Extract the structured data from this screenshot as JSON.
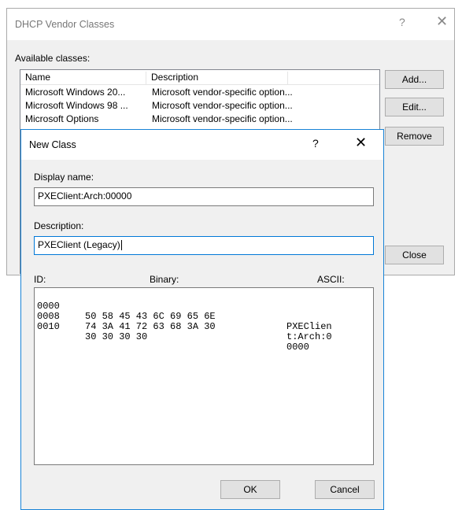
{
  "vendor_dialog": {
    "title": "DHCP Vendor Classes",
    "help_glyph": "?",
    "close_glyph": "✕",
    "available_label": "Available classes:",
    "columns": [
      "Name",
      "Description"
    ],
    "rows": [
      {
        "name": "Microsoft Windows 20...",
        "description": "Microsoft vendor-specific option..."
      },
      {
        "name": "Microsoft Windows 98 ...",
        "description": "Microsoft vendor-specific option..."
      },
      {
        "name": "Microsoft Options",
        "description": "Microsoft vendor-specific option..."
      }
    ],
    "buttons": {
      "add": "Add...",
      "edit": "Edit...",
      "remove": "Remove",
      "close": "Close"
    }
  },
  "new_class_dialog": {
    "title": "New Class",
    "help_glyph": "?",
    "close_glyph": "✕",
    "display_name_label": "Display name:",
    "display_name_value": "PXEClient:Arch:00000",
    "description_label": "Description:",
    "description_value": "PXEClient (Legacy)",
    "id_label": "ID:",
    "binary_label": "Binary:",
    "ascii_label": "ASCII:",
    "hex_rows": [
      {
        "offset": "0000",
        "binary": "50 58 45 43 6C 69 65 6E",
        "ascii": "PXEClien"
      },
      {
        "offset": "0008",
        "binary": "74 3A 41 72 63 68 3A 30",
        "ascii": "t:Arch:0"
      },
      {
        "offset": "0010",
        "binary": "30 30 30 30",
        "ascii": "0000"
      }
    ],
    "buttons": {
      "ok": "OK",
      "cancel": "Cancel"
    }
  }
}
